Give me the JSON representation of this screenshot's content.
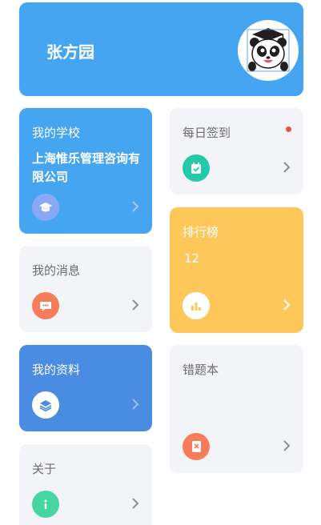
{
  "header": {
    "user_name": "张方园"
  },
  "cards": {
    "school": {
      "title": "我的学校",
      "value": "上海惟乐管理咨询有限公司"
    },
    "sign_in": {
      "title": "每日签到"
    },
    "ranking": {
      "title": "排行榜",
      "value": "12"
    },
    "messages": {
      "title": "我的消息"
    },
    "profile": {
      "title": "我的资料"
    },
    "wrong_book": {
      "title": "错题本"
    },
    "about": {
      "title": "关于"
    }
  },
  "colors": {
    "header_bg": "#45a5f1",
    "school_bg": "#45a5f1",
    "ranking_bg": "#fec759",
    "profile_bg": "#4a8ce2",
    "card_gray": "#f3f4f8",
    "sign_icon": "#24c9a8",
    "message_icon": "#f67c5c",
    "wrong_icon": "#f67c5c",
    "about_icon": "#45d6a4",
    "notify_dot": "#f24c4c"
  },
  "icons": {
    "avatar": "panda-avatar",
    "school": "graduation-cap-icon",
    "sign_in": "calendar-check-icon",
    "ranking": "bar-chart-icon",
    "messages": "chat-bubble-icon",
    "profile": "layers-icon",
    "wrong_book": "error-book-icon",
    "about": "info-icon"
  }
}
